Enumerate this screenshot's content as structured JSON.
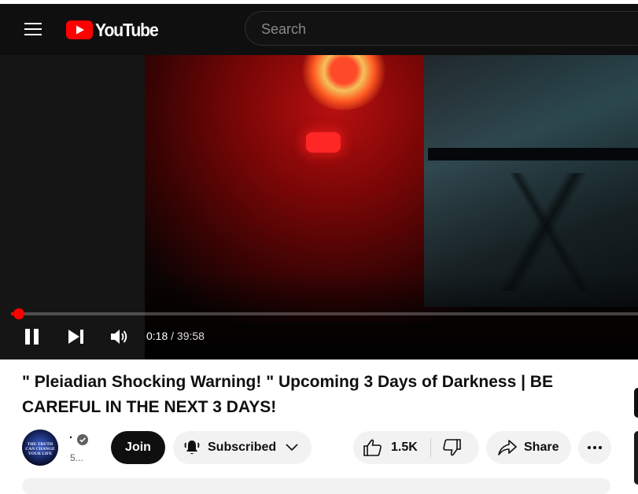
{
  "header": {
    "logo_text": "YouTube",
    "search_placeholder": "Search"
  },
  "player": {
    "current_time": "0:18",
    "time_separator": " / ",
    "duration": "39:58",
    "progress_fraction": 0.0075
  },
  "video": {
    "title": "\" Pleiadian Shocking Warning! \" Upcoming 3 Days of Darkness | BE CAREFUL IN THE NEXT 3 DAYS!"
  },
  "channel": {
    "name": "·",
    "subscribers": "5...",
    "avatar_text": "THE TRUTH CAN CHANGE YOUR LIFE"
  },
  "actions": {
    "join_label": "Join",
    "subscribed_label": "Subscribed",
    "like_count": "1.5K",
    "share_label": "Share"
  },
  "colors": {
    "accent": "#ff0000",
    "masthead": "#0f0f0f",
    "pill_bg": "#f2f2f2"
  },
  "icons": [
    "menu-icon",
    "youtube-logo-icon",
    "pause-icon",
    "next-icon",
    "volume-icon",
    "verified-icon",
    "bell-icon",
    "chevron-down-icon",
    "like-icon",
    "dislike-icon",
    "share-icon",
    "more-icon"
  ]
}
